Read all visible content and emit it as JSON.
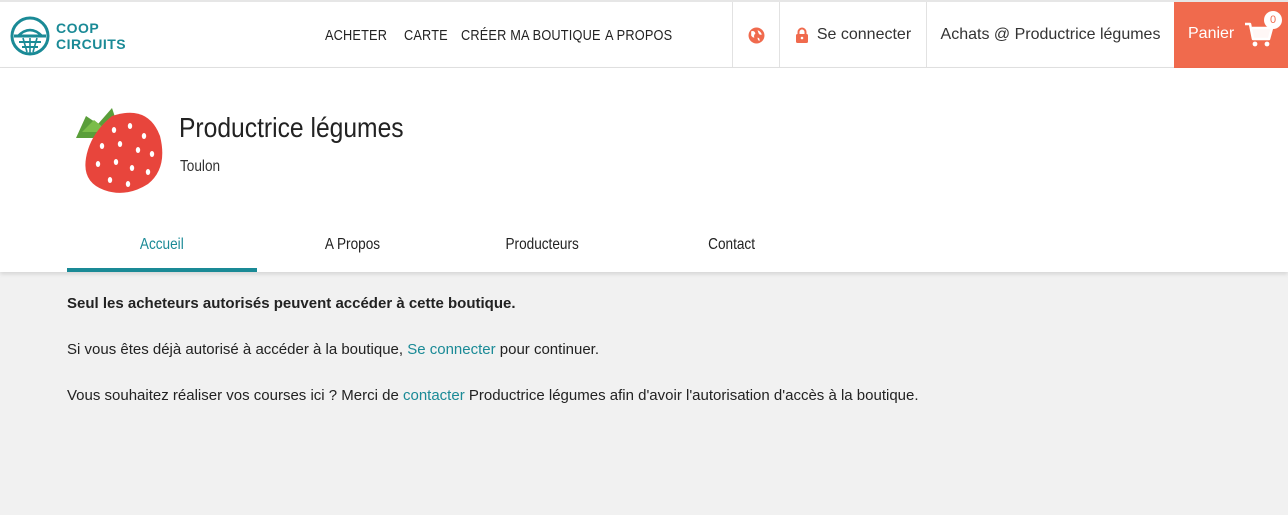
{
  "brand": {
    "line1": "COOP",
    "line2": "CIRCUITS",
    "color": "#1a8a96"
  },
  "nav": {
    "items": [
      "ACHETER",
      "CARTE",
      "CRÉER MA BOUTIQUE",
      "A PROPOS"
    ]
  },
  "topbar": {
    "globe_icon": "globe-icon",
    "login_label": "Se connecter",
    "shop_label": "Achats @ Productrice légumes",
    "cart_label": "Panier",
    "cart_count": "0",
    "cart_color": "#f06a4d"
  },
  "shop": {
    "name": "Productrice légumes",
    "city": "Toulon",
    "logo_icon": "strawberry-icon"
  },
  "tabs": [
    {
      "label": "Accueil",
      "active": true
    },
    {
      "label": "A Propos",
      "active": false
    },
    {
      "label": "Producteurs",
      "active": false
    },
    {
      "label": "Contact",
      "active": false
    }
  ],
  "content": {
    "restricted": "Seul les acheteurs autorisés peuvent accéder à cette boutique.",
    "login_prefix": "Si vous êtes déjà autorisé à accéder à la boutique, ",
    "login_link": "Se connecter",
    "login_suffix": " pour continuer.",
    "contact_prefix": "Vous souhaitez réaliser vos courses ici ? Merci de ",
    "contact_link": "contacter",
    "contact_suffix": " Productrice légumes afin d'avoir l'autorisation d'accès à la boutique."
  }
}
